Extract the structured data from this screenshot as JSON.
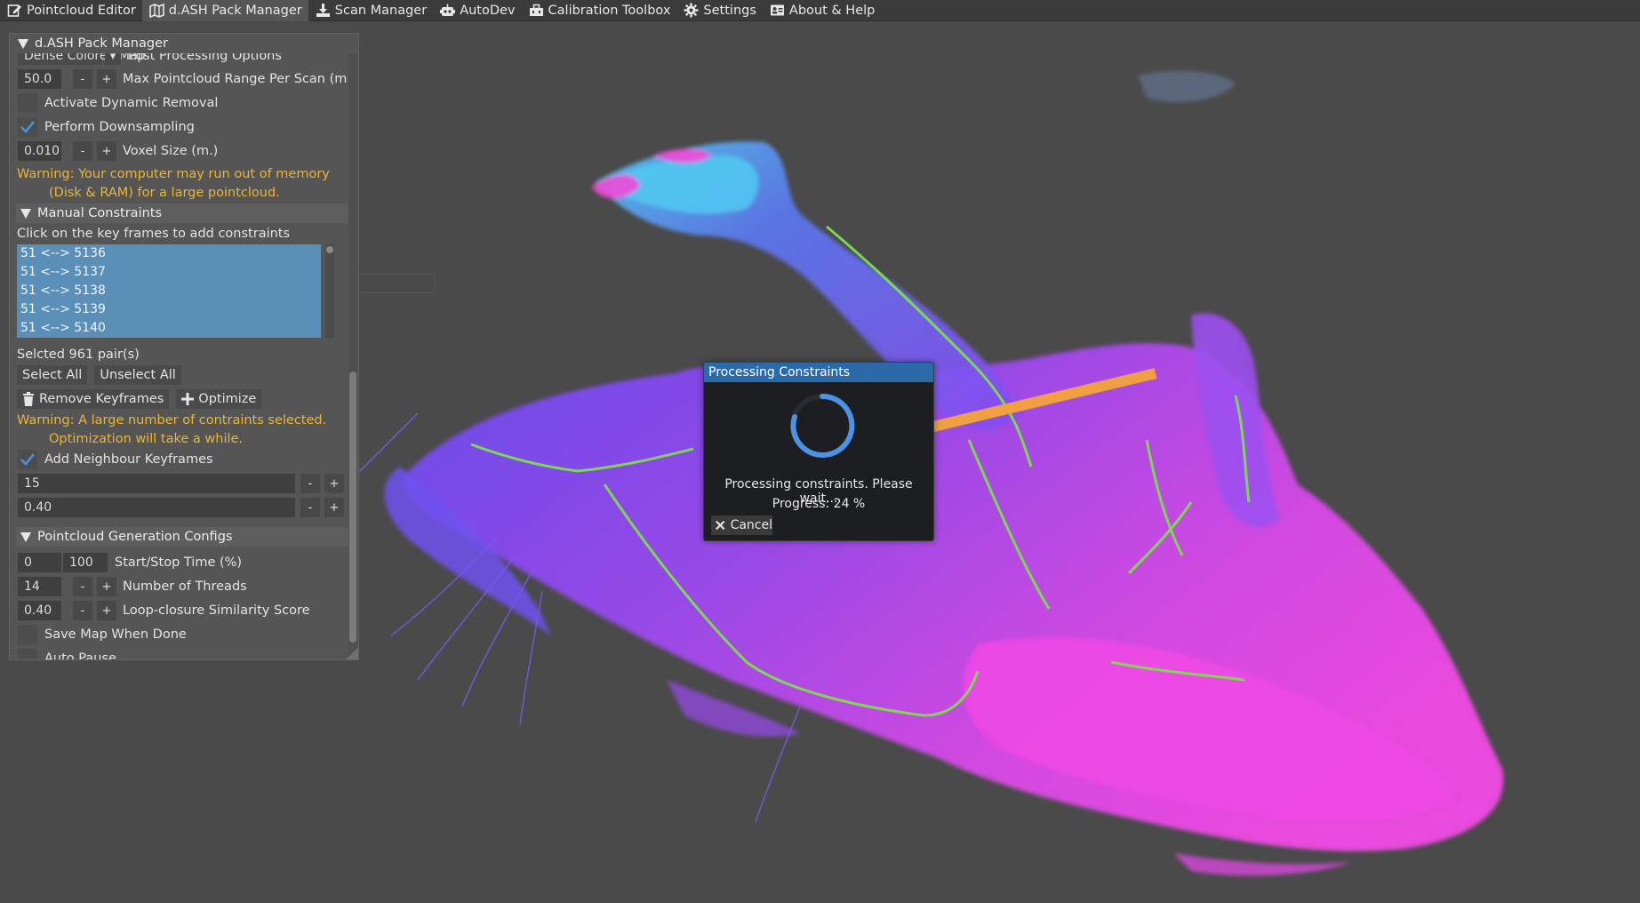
{
  "menubar": {
    "items": [
      {
        "label": "Pointcloud Editor",
        "icon": "edit-icon"
      },
      {
        "label": "d.ASH Pack Manager",
        "icon": "map-icon"
      },
      {
        "label": "Scan Manager",
        "icon": "download-icon"
      },
      {
        "label": "AutoDev",
        "icon": "robot-icon"
      },
      {
        "label": "Calibration Toolbox",
        "icon": "toolbox-icon"
      },
      {
        "label": "Settings",
        "icon": "gear-icon"
      },
      {
        "label": "About & Help",
        "icon": "id-card-icon"
      }
    ],
    "active_index": 1
  },
  "panel": {
    "title": "d.ASH Pack Manager",
    "top_clipped": {
      "dropdown_value": "Dense Colored Map",
      "label": "Post Processing Options"
    },
    "max_range": {
      "value": "50.0",
      "minus": "-",
      "plus": "+",
      "label": "Max Pointcloud Range Per Scan (m.)"
    },
    "dynamic_removal": {
      "label": "Activate Dynamic Removal",
      "checked": false
    },
    "downsampling": {
      "label": "Perform Downsampling",
      "checked": true
    },
    "voxel_size": {
      "value": "0.010",
      "minus": "-",
      "plus": "+",
      "label": "Voxel Size (m.)"
    },
    "memory_warning": {
      "line1": "Warning: Your computer may run out of memory",
      "line2": "(Disk & RAM) for a large pointcloud."
    },
    "manual_constraints": {
      "header": "Manual Constraints",
      "instruction": "Click on the key frames to add constraints",
      "pairs": [
        "51 <--> 5136",
        "51 <--> 5137",
        "51 <--> 5138",
        "51 <--> 5139",
        "51 <--> 5140"
      ],
      "selected_text": "Selcted 961 pair(s)",
      "select_all": "Select All",
      "unselect_all": "Unselect All",
      "remove_keyframes": "Remove Keyframes",
      "optimize": "Optimize",
      "warning_line1": "Warning: A large number of contraints selected.",
      "warning_line2": "Optimization will take a while.",
      "add_neighbour": {
        "label": "Add Neighbour Keyframes",
        "checked": true
      },
      "slider1": {
        "value": "15",
        "minus": "-",
        "plus": "+"
      },
      "slider2": {
        "value": "0.40",
        "minus": "-",
        "plus": "+"
      }
    },
    "generation": {
      "header": "Pointcloud Generation Configs",
      "start_stop": {
        "start": "0",
        "stop": "100",
        "label": "Start/Stop Time (%)"
      },
      "threads": {
        "value": "14",
        "minus": "-",
        "plus": "+",
        "label": "Number of Threads"
      },
      "similarity": {
        "value": "0.40",
        "minus": "-",
        "plus": "+",
        "label": "Loop-closure Similarity Score"
      },
      "save_map": {
        "label": "Save Map When Done",
        "checked": false
      },
      "auto_pause": {
        "label": "Auto Pause"
      }
    }
  },
  "dialog": {
    "title": "Processing Constraints",
    "message": "Processing constraints. Please wait...",
    "progress_text": "Progress: 24 %",
    "progress_percent": 24,
    "cancel_label": "Cancel"
  },
  "colors": {
    "accent_blue": "#2a6aa8",
    "selection_blue": "#5a8fb8",
    "warning_yellow": "#e8b63c",
    "checkmark": "#4b8fe0",
    "pointcloud_magenta": "#e040e0",
    "pointcloud_violet": "#8a4af0",
    "pointcloud_cyan": "#40c8f0",
    "trajectory_green": "#7be04a",
    "trajectory_orange": "#f0a040"
  }
}
